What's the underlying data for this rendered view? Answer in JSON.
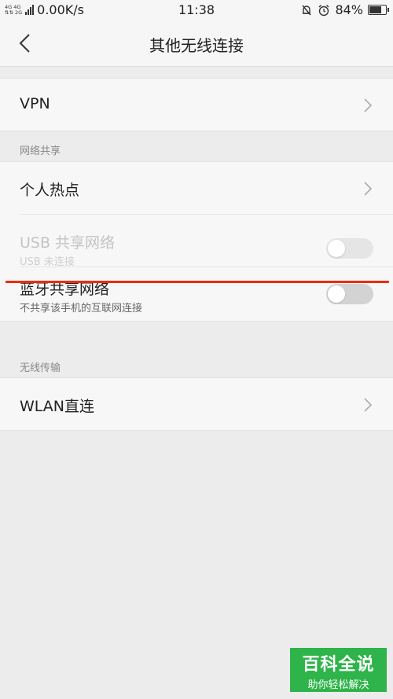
{
  "status_bar": {
    "net_types": "4G 4G",
    "net_arrows": "⇅⇅ 2G",
    "speed": "0.00K/s",
    "time": "11:38",
    "battery": "84%",
    "battery_level": 0.84
  },
  "header": {
    "title": "其他无线连接"
  },
  "vpn": {
    "label": "VPN"
  },
  "sharing": {
    "section_label": "网络共享",
    "hotspot_label": "个人热点",
    "usb": {
      "label": "USB 共享网络",
      "sub": "USB 未连接",
      "on": false
    },
    "bluetooth": {
      "label": "蓝牙共享网络",
      "sub": "不共享该手机的互联网连接",
      "on": false
    }
  },
  "wireless": {
    "section_label": "无线传输",
    "wlan_direct_label": "WLAN直连"
  },
  "watermark": {
    "title": "百科全说",
    "subtitle": "助你轻松解决"
  },
  "colors": {
    "highlight_red": "#ee2b0c",
    "watermark_green": "#2eb44a",
    "background": "#ececec"
  }
}
